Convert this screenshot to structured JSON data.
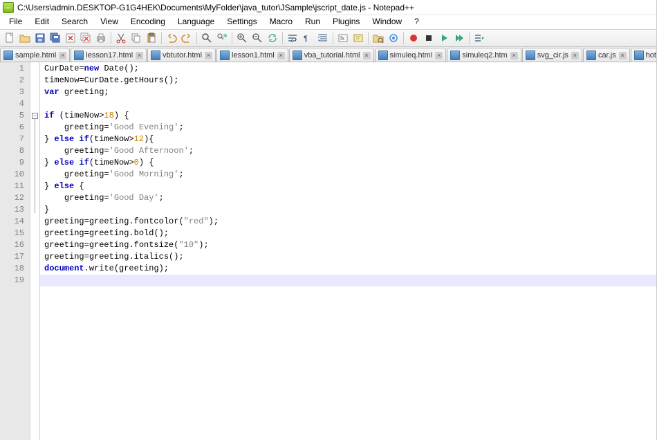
{
  "title": "C:\\Users\\admin.DESKTOP-G1G4HEK\\Documents\\MyFolder\\java_tutor\\JSample\\jscript_date.js - Notepad++",
  "menu": {
    "file": "File",
    "edit": "Edit",
    "search": "Search",
    "view": "View",
    "encoding": "Encoding",
    "language": "Language",
    "settings": "Settings",
    "macro": "Macro",
    "run": "Run",
    "plugins": "Plugins",
    "window": "Window",
    "help": "?"
  },
  "tabs": [
    {
      "label": "sample.html"
    },
    {
      "label": "lesson17.html"
    },
    {
      "label": "vbtutor.html"
    },
    {
      "label": "lesson1.html"
    },
    {
      "label": "vba_tutorial.html"
    },
    {
      "label": "simuleq.html"
    },
    {
      "label": "simuleq2.htm"
    },
    {
      "label": "svg_cir.js"
    },
    {
      "label": "car.js"
    },
    {
      "label": "hotel.html"
    }
  ],
  "code": {
    "lines": [
      {
        "n": "1",
        "ind": "",
        "tokens": [
          {
            "t": "CurDate",
            "c": "idn"
          },
          {
            "t": "=",
            "c": "op"
          },
          {
            "t": "new ",
            "c": "kw"
          },
          {
            "t": "Date",
            "c": "cls"
          },
          {
            "t": "();",
            "c": "op"
          }
        ]
      },
      {
        "n": "2",
        "ind": "",
        "tokens": [
          {
            "t": "timeNow",
            "c": "idn"
          },
          {
            "t": "=",
            "c": "op"
          },
          {
            "t": "CurDate",
            "c": "idn"
          },
          {
            "t": ".",
            "c": "op"
          },
          {
            "t": "getHours",
            "c": "fn"
          },
          {
            "t": "();",
            "c": "op"
          }
        ]
      },
      {
        "n": "3",
        "ind": "",
        "tokens": [
          {
            "t": "var ",
            "c": "kw"
          },
          {
            "t": "greeting",
            "c": "idn"
          },
          {
            "t": ";",
            "c": "op"
          }
        ]
      },
      {
        "n": "4",
        "ind": "",
        "tokens": []
      },
      {
        "n": "5",
        "ind": "",
        "tokens": [
          {
            "t": "if ",
            "c": "kw"
          },
          {
            "t": "(",
            "c": "op"
          },
          {
            "t": "timeNow",
            "c": "idn"
          },
          {
            "t": ">",
            "c": "op"
          },
          {
            "t": "18",
            "c": "num"
          },
          {
            "t": ") {",
            "c": "op"
          }
        ]
      },
      {
        "n": "6",
        "ind": "    ",
        "tokens": [
          {
            "t": "greeting",
            "c": "idn"
          },
          {
            "t": "=",
            "c": "op"
          },
          {
            "t": "'Good Evening'",
            "c": "str"
          },
          {
            "t": ";",
            "c": "op"
          }
        ]
      },
      {
        "n": "7",
        "ind": "",
        "tokens": [
          {
            "t": "} ",
            "c": "op"
          },
          {
            "t": "else if",
            "c": "kw"
          },
          {
            "t": "(",
            "c": "op"
          },
          {
            "t": "timeNow",
            "c": "idn"
          },
          {
            "t": ">",
            "c": "op"
          },
          {
            "t": "12",
            "c": "num"
          },
          {
            "t": "){",
            "c": "op"
          }
        ]
      },
      {
        "n": "8",
        "ind": "    ",
        "tokens": [
          {
            "t": "greeting",
            "c": "idn"
          },
          {
            "t": "=",
            "c": "op"
          },
          {
            "t": "'Good Afternoon'",
            "c": "str"
          },
          {
            "t": ";",
            "c": "op"
          }
        ]
      },
      {
        "n": "9",
        "ind": "",
        "tokens": [
          {
            "t": "} ",
            "c": "op"
          },
          {
            "t": "else if",
            "c": "kw"
          },
          {
            "t": "(",
            "c": "op"
          },
          {
            "t": "timeNow",
            "c": "idn"
          },
          {
            "t": ">",
            "c": "op"
          },
          {
            "t": "0",
            "c": "num"
          },
          {
            "t": ") {",
            "c": "op"
          }
        ]
      },
      {
        "n": "10",
        "ind": "    ",
        "tokens": [
          {
            "t": "greeting",
            "c": "idn"
          },
          {
            "t": "=",
            "c": "op"
          },
          {
            "t": "'Good Morning'",
            "c": "str"
          },
          {
            "t": ";",
            "c": "op"
          }
        ]
      },
      {
        "n": "11",
        "ind": "",
        "tokens": [
          {
            "t": "} ",
            "c": "op"
          },
          {
            "t": "else ",
            "c": "kw"
          },
          {
            "t": "{",
            "c": "op"
          }
        ]
      },
      {
        "n": "12",
        "ind": "    ",
        "tokens": [
          {
            "t": "greeting",
            "c": "idn"
          },
          {
            "t": "=",
            "c": "op"
          },
          {
            "t": "'Good Day'",
            "c": "str"
          },
          {
            "t": ";",
            "c": "op"
          }
        ]
      },
      {
        "n": "13",
        "ind": "",
        "tokens": [
          {
            "t": "}",
            "c": "op"
          }
        ]
      },
      {
        "n": "14",
        "ind": "",
        "tokens": [
          {
            "t": "greeting",
            "c": "idn"
          },
          {
            "t": "=",
            "c": "op"
          },
          {
            "t": "greeting",
            "c": "idn"
          },
          {
            "t": ".",
            "c": "op"
          },
          {
            "t": "fontcolor",
            "c": "fn"
          },
          {
            "t": "(",
            "c": "op"
          },
          {
            "t": "\"red\"",
            "c": "str"
          },
          {
            "t": ");",
            "c": "op"
          }
        ]
      },
      {
        "n": "15",
        "ind": "",
        "tokens": [
          {
            "t": "greeting",
            "c": "idn"
          },
          {
            "t": "=",
            "c": "op"
          },
          {
            "t": "greeting",
            "c": "idn"
          },
          {
            "t": ".",
            "c": "op"
          },
          {
            "t": "bold",
            "c": "fn"
          },
          {
            "t": "();",
            "c": "op"
          }
        ]
      },
      {
        "n": "16",
        "ind": "",
        "tokens": [
          {
            "t": "greeting",
            "c": "idn"
          },
          {
            "t": "=",
            "c": "op"
          },
          {
            "t": "greeting",
            "c": "idn"
          },
          {
            "t": ".",
            "c": "op"
          },
          {
            "t": "fontsize",
            "c": "fn"
          },
          {
            "t": "(",
            "c": "op"
          },
          {
            "t": "\"10\"",
            "c": "str"
          },
          {
            "t": ");",
            "c": "op"
          }
        ]
      },
      {
        "n": "17",
        "ind": "",
        "tokens": [
          {
            "t": "greeting",
            "c": "idn"
          },
          {
            "t": "=",
            "c": "op"
          },
          {
            "t": "greeting",
            "c": "idn"
          },
          {
            "t": ".",
            "c": "op"
          },
          {
            "t": "italics",
            "c": "fn"
          },
          {
            "t": "();",
            "c": "op"
          }
        ]
      },
      {
        "n": "18",
        "ind": "",
        "tokens": [
          {
            "t": "document",
            "c": "kw"
          },
          {
            "t": ".",
            "c": "op"
          },
          {
            "t": "write",
            "c": "fn"
          },
          {
            "t": "(",
            "c": "op"
          },
          {
            "t": "greeting",
            "c": "idn"
          },
          {
            "t": ");",
            "c": "op"
          }
        ]
      },
      {
        "n": "19",
        "ind": "",
        "tokens": []
      }
    ]
  },
  "toolbar_icons": [
    "new",
    "open",
    "save",
    "save-all",
    "close",
    "close-all",
    "print",
    "sep",
    "cut",
    "copy",
    "paste",
    "sep",
    "undo",
    "redo",
    "sep",
    "find",
    "replace",
    "sep",
    "zoom-in",
    "zoom-out",
    "sync",
    "sep",
    "wordwrap",
    "allchars",
    "indent-guide",
    "sep",
    "lang",
    "eol",
    "sep",
    "folder",
    "monitor",
    "sep",
    "record",
    "stop",
    "play",
    "play-multi",
    "sep",
    "playlist"
  ]
}
